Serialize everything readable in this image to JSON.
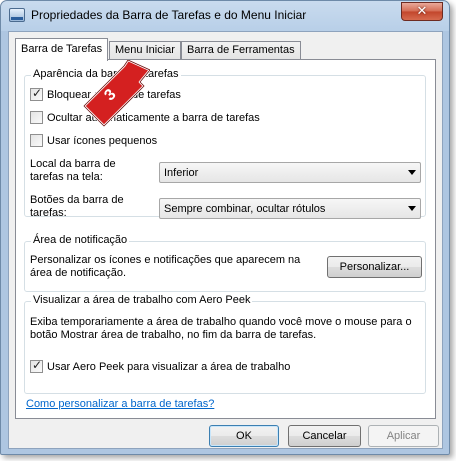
{
  "window": {
    "title": "Propriedades da Barra de Tarefas e do Menu Iniciar",
    "close_glyph": "✕"
  },
  "tabs": [
    {
      "label": "Barra de Tarefas",
      "active": true
    },
    {
      "label": "Menu Iniciar",
      "active": false
    },
    {
      "label": "Barra de Ferramentas",
      "active": false
    }
  ],
  "appearance": {
    "title": "Aparência da barra de tarefas",
    "lock_label": "Bloquear a barra de tarefas",
    "lock_checked": true,
    "autohide_label": "Ocultar automaticamente a barra de tarefas",
    "autohide_checked": false,
    "small_icons_label": "Usar ícones pequenos",
    "small_icons_checked": false,
    "location_label": "Local da barra de tarefas na tela:",
    "location_value": "Inferior",
    "buttons_label": "Botões da barra de tarefas:",
    "buttons_value": "Sempre combinar, ocultar rótulos"
  },
  "notification": {
    "title": "Área de notificação",
    "description": "Personalizar os ícones e notificações que aparecem na área de notificação.",
    "customize_button": "Personalizar..."
  },
  "aero_peek": {
    "title": "Visualizar a área de trabalho com Aero Peek",
    "description": "Exiba temporariamente a área de trabalho quando você move o mouse para o botão Mostrar área de trabalho, no fim da barra de tarefas.",
    "use_label": "Usar Aero Peek para visualizar a área de trabalho",
    "use_checked": true
  },
  "help_link": "Como personalizar a barra de tarefas?",
  "footer": {
    "ok": "OK",
    "cancel": "Cancelar",
    "apply": "Aplicar"
  },
  "annotation": {
    "step_number": "3",
    "color": "#d42020"
  }
}
